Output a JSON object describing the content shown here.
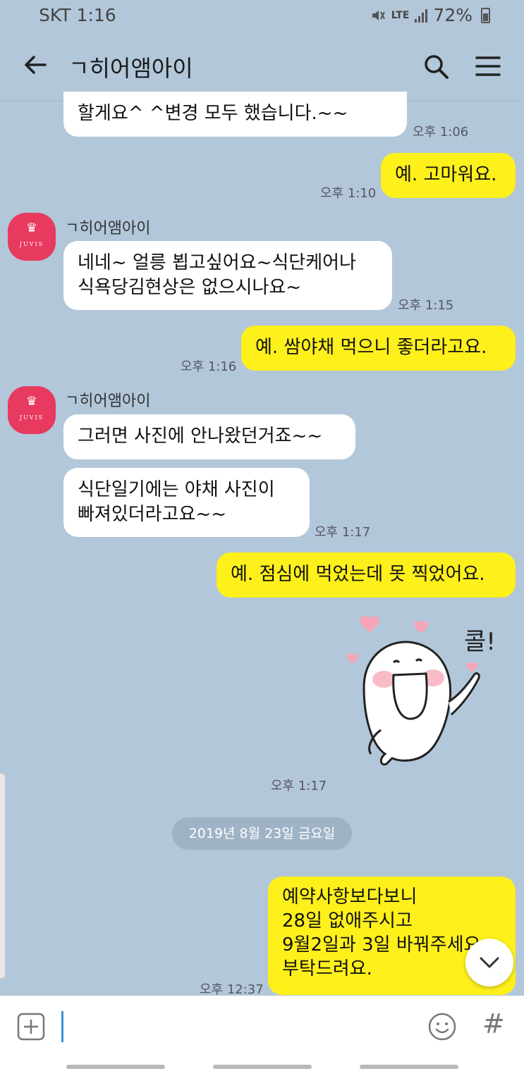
{
  "status_bar": {
    "carrier_time": "SKT 1:16",
    "network": "LTE",
    "battery": "72%"
  },
  "header": {
    "title": "ㄱ히어앰아이",
    "icons": [
      "back-arrow-icon",
      "search-icon",
      "menu-icon"
    ]
  },
  "messages": {
    "m1": {
      "text": "할게요^ ^변경 모두 했습니다.~~",
      "time": "오후 1:06"
    },
    "m2": {
      "text": "예. 고마워요.",
      "time": "오후 1:10"
    },
    "m3": {
      "sender": "ㄱ히어앰아이",
      "line1": "네네~ 얼릉 뵙고싶어요~식단케어나",
      "line2": "식욕당김현상은 없으시나요~",
      "time": "오후 1:15"
    },
    "m4": {
      "text": "예. 쌈야채 먹으니 좋더라고요.",
      "time": "오후 1:16"
    },
    "m5": {
      "sender": "ㄱ히어앰아이",
      "text": "그러면 사진에 안나왔던거죠~~"
    },
    "m6": {
      "line1": "식단일기에는 야채 사진이",
      "line2": "빠져있더라고요~~",
      "time": "오후 1:17"
    },
    "m7": {
      "text": "예. 점심에 먹었는데 못 찍었어요."
    },
    "m8": {
      "sticker_text": "콜!",
      "time": "오후 1:17"
    },
    "date_divider": "2019년 8월 23일 금요일",
    "m9": {
      "line1": "예약사항보다보니",
      "line2": "28일 없애주시고",
      "line3": "9월2일과 3일 바꿔주세요.",
      "line4": "부탁드려요.",
      "time": "오후 12:37"
    }
  },
  "avatar": {
    "brand": "JUVIS",
    "color": "#e8395f"
  },
  "colors": {
    "background": "#b2c7d9",
    "outgoing": "#fef01b",
    "incoming": "#ffffff"
  },
  "input_bar": {
    "icons": [
      "plus-icon",
      "emoji-icon",
      "hash-icon"
    ],
    "hash_label": "#"
  }
}
